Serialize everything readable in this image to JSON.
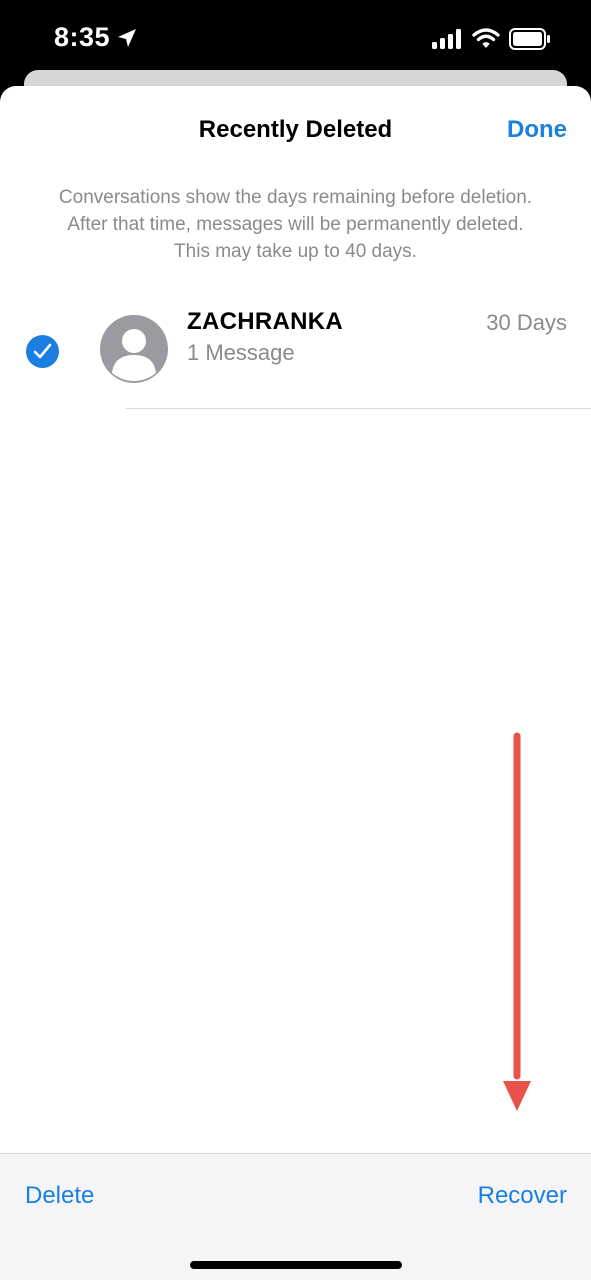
{
  "status_bar": {
    "time": "8:35",
    "icons": [
      "location-arrow-icon",
      "cellular-signal-icon",
      "wifi-icon",
      "battery-icon"
    ]
  },
  "sheet": {
    "title": "Recently Deleted",
    "done_label": "Done",
    "info_lines": [
      "Conversations show the days remaining before deletion.",
      "After that time, messages will be permanently deleted.",
      "This may take up to 40 days."
    ]
  },
  "conversations": [
    {
      "name": "ZACHRANKA",
      "subtitle": "1 Message",
      "days_remaining": "30 Days",
      "selected": true,
      "avatar_icon": "person-icon"
    }
  ],
  "toolbar": {
    "delete_label": "Delete",
    "recover_label": "Recover"
  },
  "colors": {
    "accent": "#1a7fe0",
    "secondary_text": "#8a8a8e",
    "annotation_arrow": "#e8524a"
  }
}
